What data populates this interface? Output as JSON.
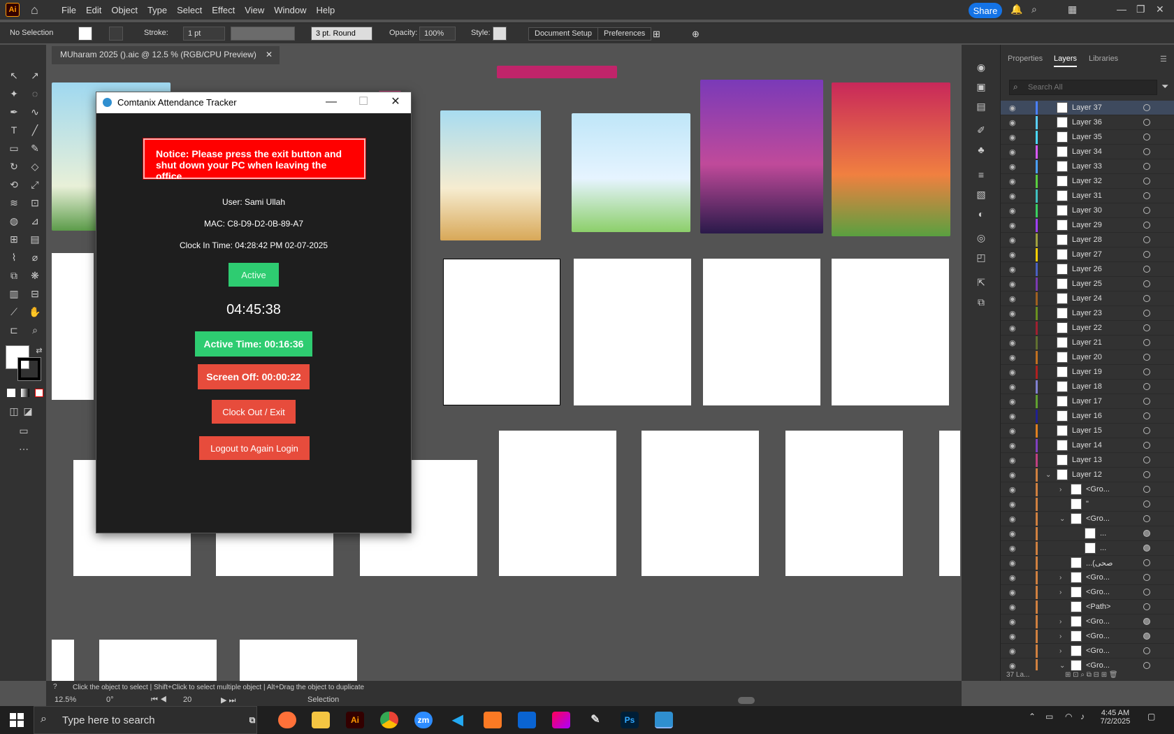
{
  "menubar": {
    "app_logo": "Ai",
    "items": [
      "File",
      "Edit",
      "Object",
      "Type",
      "Select",
      "Effect",
      "View",
      "Window",
      "Help"
    ],
    "share_label": "Share"
  },
  "controlbar": {
    "selection": "No Selection",
    "stroke_label": "Stroke:",
    "stroke_value": "1 pt",
    "brush_value": "3 pt. Round",
    "opacity_label": "Opacity:",
    "opacity_value": "100%",
    "style_label": "Style:",
    "document_setup": "Document Setup",
    "preferences": "Preferences"
  },
  "document": {
    "tab_title": "MUharam 2025 ().aic @ 12.5 % (RGB/CPU Preview)"
  },
  "right_panel": {
    "tabs": [
      "Properties",
      "Layers",
      "Libraries"
    ],
    "active_tab": "Layers",
    "search_placeholder": "Search All",
    "footer": "37 La..."
  },
  "layers": [
    {
      "name": "Layer 37",
      "color": "#4a80ff",
      "selected": true
    },
    {
      "name": "Layer 36",
      "color": "#5acfff"
    },
    {
      "name": "Layer 35",
      "color": "#4ad8ff"
    },
    {
      "name": "Layer 34",
      "color": "#d85aff"
    },
    {
      "name": "Layer 33",
      "color": "#4aa0ff"
    },
    {
      "name": "Layer 32",
      "color": "#5acf40"
    },
    {
      "name": "Layer 31",
      "color": "#40c0c0"
    },
    {
      "name": "Layer 30",
      "color": "#3acf60"
    },
    {
      "name": "Layer 29",
      "color": "#a040ff"
    },
    {
      "name": "Layer 28",
      "color": "#a0a040"
    },
    {
      "name": "Layer 27",
      "color": "#ffd000"
    },
    {
      "name": "Layer 26",
      "color": "#4a60c0"
    },
    {
      "name": "Layer 25",
      "color": "#7a3ab0"
    },
    {
      "name": "Layer 24",
      "color": "#a06020"
    },
    {
      "name": "Layer 23",
      "color": "#6a9020"
    },
    {
      "name": "Layer 22",
      "color": "#a02030"
    },
    {
      "name": "Layer 21",
      "color": "#607030"
    },
    {
      "name": "Layer 20",
      "color": "#c07020"
    },
    {
      "name": "Layer 19",
      "color": "#b02020"
    },
    {
      "name": "Layer 18",
      "color": "#8080d0"
    },
    {
      "name": "Layer 17",
      "color": "#60a030"
    },
    {
      "name": "Layer 16",
      "color": "#202090"
    },
    {
      "name": "Layer 15",
      "color": "#e08020"
    },
    {
      "name": "Layer 14",
      "color": "#8040c0"
    },
    {
      "name": "Layer 13",
      "color": "#c04080"
    },
    {
      "name": "Layer 12",
      "color": "#d08040",
      "expanded": true
    },
    {
      "name": "<Gro...",
      "color": "#d08040",
      "depth": 1,
      "chevron": "right"
    },
    {
      "name": "\"",
      "color": "#d08040",
      "depth": 1
    },
    {
      "name": "<Gro...",
      "color": "#d08040",
      "depth": 1,
      "chevron": "down"
    },
    {
      "name": "...",
      "color": "#d08040",
      "depth": 2,
      "filled": true
    },
    {
      "name": "...",
      "color": "#d08040",
      "depth": 2,
      "filled": true
    },
    {
      "name": "...(صحی",
      "color": "#d08040",
      "depth": 1
    },
    {
      "name": "<Gro...",
      "color": "#d08040",
      "depth": 1,
      "chevron": "right"
    },
    {
      "name": "<Gro...",
      "color": "#d08040",
      "depth": 1,
      "chevron": "right"
    },
    {
      "name": "<Path>",
      "color": "#d08040",
      "depth": 1
    },
    {
      "name": "<Gro...",
      "color": "#d08040",
      "depth": 1,
      "chevron": "right",
      "filled": true
    },
    {
      "name": "<Gro...",
      "color": "#d08040",
      "depth": 1,
      "chevron": "right",
      "filled": true
    },
    {
      "name": "<Gro...",
      "color": "#d08040",
      "depth": 1,
      "chevron": "right"
    },
    {
      "name": "<Gro...",
      "color": "#d08040",
      "depth": 1,
      "chevron": "down"
    },
    {
      "name": "...",
      "color": "#d08040",
      "depth": 2,
      "chevron": "right"
    }
  ],
  "statusbar": {
    "hint": "Click the object to select  |  Shift+Click to select multiple object  |  Alt+Drag the object to duplicate",
    "zoom": "12.5%",
    "rotation": "0°",
    "artboard": "20",
    "mode": "Selection"
  },
  "attendance": {
    "window_title": "Comtanix Attendance Tracker",
    "notice": "Notice: Please press the exit button and shut down your PC when leaving the office",
    "user": "User: Sami Ullah",
    "mac": "MAC: C8-D9-D2-0B-89-A7",
    "clock_in": "Clock In Time: 04:28:42 PM 02-07-2025",
    "status": "Active",
    "timer": "04:45:38",
    "active_time": "Active Time: 00:16:36",
    "screen_off": "Screen Off: 00:00:22",
    "clock_out": "Clock Out / Exit",
    "logout": "Logout to Again Login"
  },
  "taskbar": {
    "search_placeholder": "Type here to search",
    "apps": [
      "Ai",
      "zm",
      "Ps"
    ],
    "time": "4:45 AM",
    "date": "7/2/2025"
  },
  "colors": {
    "accent": "#1473e6",
    "notice_red": "#ff0000",
    "active_green": "#2ecc71",
    "button_red": "#e74c3c"
  }
}
